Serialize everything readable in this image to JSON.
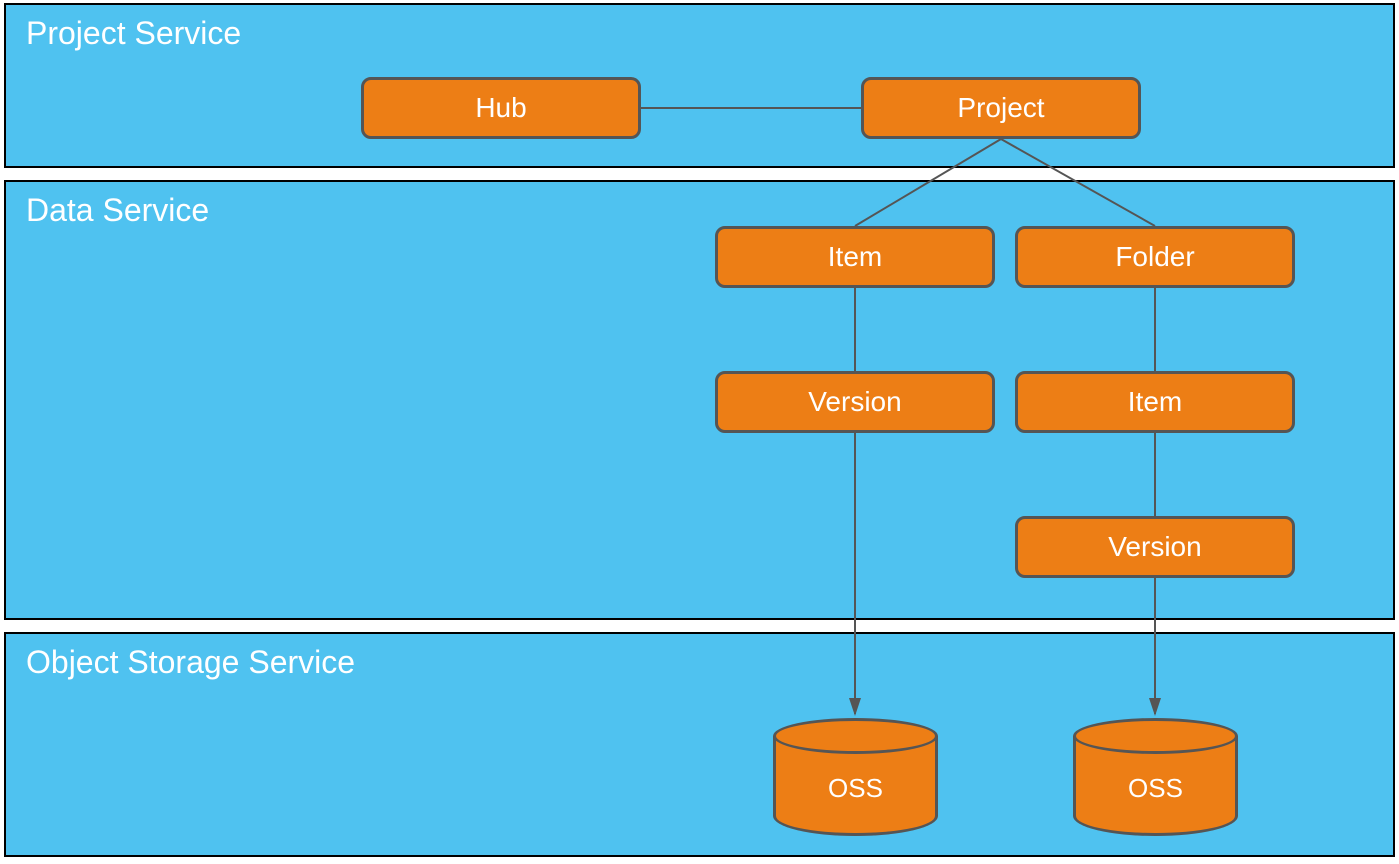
{
  "sections": {
    "project_service": {
      "title": "Project Service"
    },
    "data_service": {
      "title": "Data Service"
    },
    "object_storage_service": {
      "title": "Object Storage Service"
    }
  },
  "nodes": {
    "hub": {
      "label": "Hub"
    },
    "project": {
      "label": "Project"
    },
    "item1": {
      "label": "Item"
    },
    "folder": {
      "label": "Folder"
    },
    "version1": {
      "label": "Version"
    },
    "item2": {
      "label": "Item"
    },
    "version2": {
      "label": "Version"
    },
    "oss1": {
      "label": "OSS"
    },
    "oss2": {
      "label": "OSS"
    }
  }
}
